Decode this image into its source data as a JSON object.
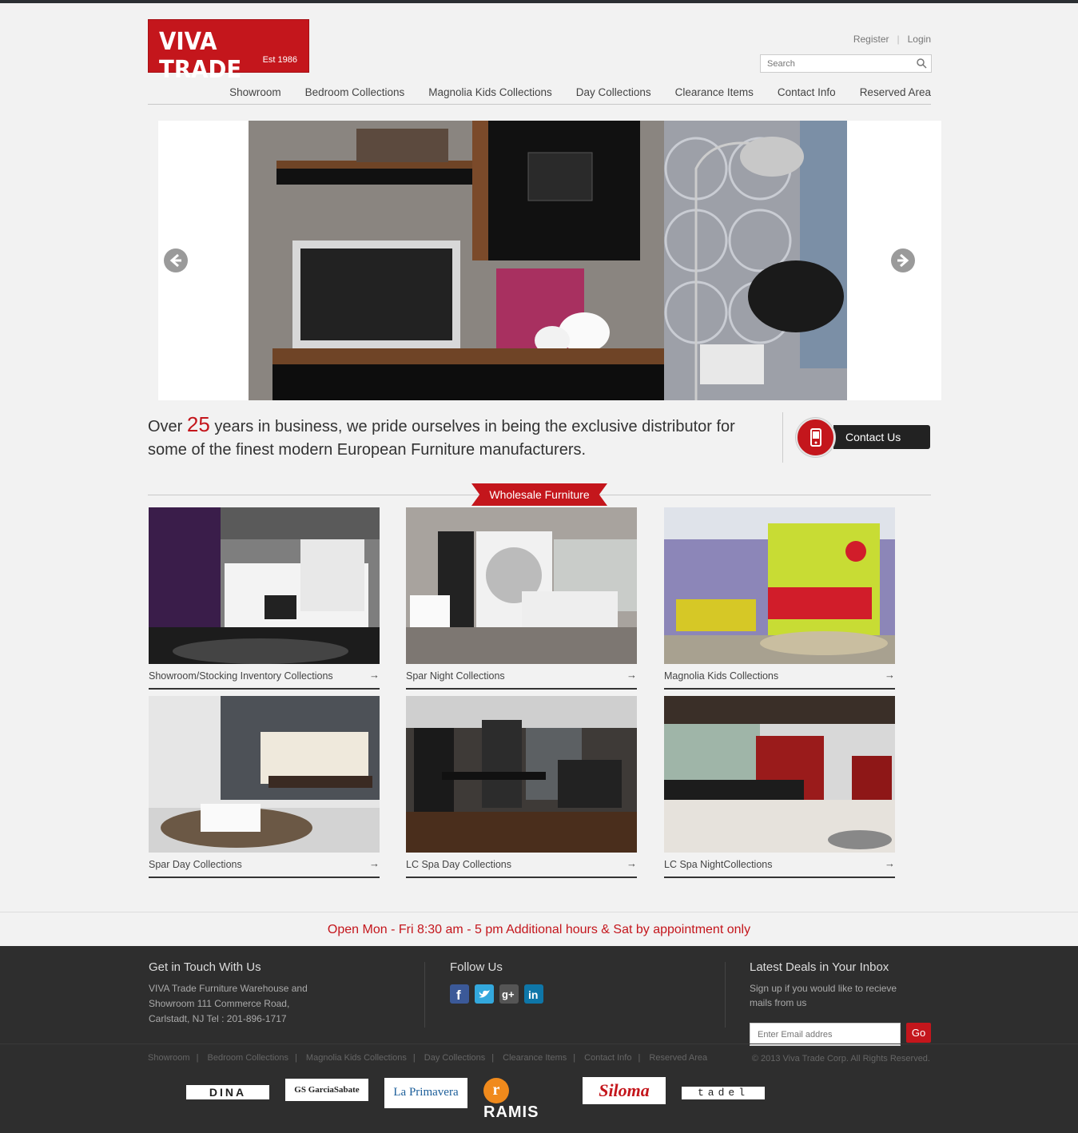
{
  "header": {
    "logo_name": "VIVA TRADE",
    "logo_est": "Est 1986",
    "register": "Register",
    "login": "Login",
    "search_placeholder": "Search"
  },
  "nav": [
    "Showroom",
    "Bedroom Collections",
    "Magnolia Kids Collections",
    "Day Collections",
    "Clearance Items",
    "Contact Info",
    "Reserved Area"
  ],
  "intro": {
    "over": "Over",
    "years": "25",
    "rest": "years in business, we pride ourselves in being the exclusive distributor for some of the finest modern European Furniture manufacturers.",
    "contact_button": "Contact Us"
  },
  "section_ribbon": "Wholesale Furniture",
  "cards": [
    {
      "caption": "Showroom/Stocking Inventory Collections"
    },
    {
      "caption": "Spar Night  Collections"
    },
    {
      "caption": "Magnolia Kids Collections"
    },
    {
      "caption": "Spar Day Collections"
    },
    {
      "caption": "LC Spa Day Collections"
    },
    {
      "caption": "LC Spa NightCollections"
    }
  ],
  "hours": "Open Mon - Fri 8:30 am - 5 pm Additional hours & Sat by appointment only",
  "footer": {
    "touch_title": "Get in Touch With Us",
    "touch_text_1": "VIVA Trade Furniture Warehouse and",
    "touch_text_2": "Showroom 111 Commerce Road,",
    "touch_text_3": "Carlstadt, NJ Tel : 201-896-1717",
    "follow_title": "Follow Us",
    "deals_title": "Latest Deals in Your Inbox",
    "deals_text_1": "Sign up if you would like to recieve",
    "deals_text_2": "mails from us",
    "email_placeholder": "Enter Email addres",
    "go": "Go",
    "copyright": "© 2013 Viva Trade Corp. All Rights Reserved."
  },
  "brands": [
    "DINA",
    "GS GarciaSabate",
    "La Primavera",
    "RAMIS",
    "Siloma",
    "tadel"
  ],
  "colors": {
    "accent": "#c4161c",
    "footer_bg": "#2e2e2e",
    "text": "#444444"
  }
}
